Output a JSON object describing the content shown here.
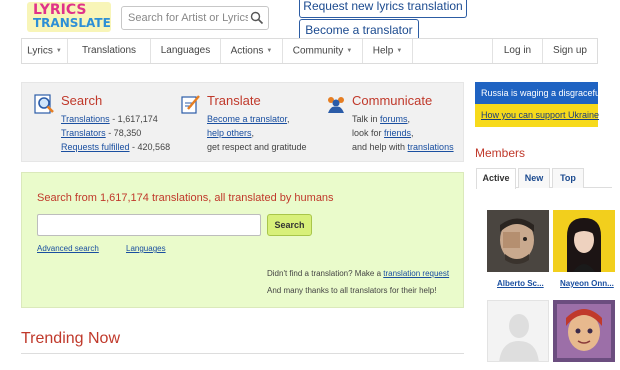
{
  "header": {
    "logo_line1": "LYRICS",
    "logo_line2": "TRANSLATE",
    "search_placeholder": "Search for Artist or Lyrics",
    "request_button": "Request new lyrics translation",
    "become_button": "Become a translator"
  },
  "nav": {
    "items": [
      "Lyrics",
      "Translations",
      "Languages",
      "Actions",
      "Community",
      "Help"
    ],
    "login": "Log in",
    "signup": "Sign up"
  },
  "features": {
    "search": {
      "title": "Search",
      "line1_link": "Translations",
      "line1_rest": " - 1,617,174",
      "line2_link": "Translators",
      "line2_rest": " - 78,350",
      "line3_link": "Requests fulfilled",
      "line3_rest": " - 420,568"
    },
    "translate": {
      "title": "Translate",
      "line1_link": "Become a translator",
      "line1_rest": ",",
      "line2_link": "help others",
      "line2_rest": ",",
      "line3": "get respect and gratitude"
    },
    "communicate": {
      "title": "Communicate",
      "line1_pre": "Talk in ",
      "line1_link": "forums",
      "line1_rest": ",",
      "line2_pre": "look for ",
      "line2_link": "friends",
      "line2_rest": ",",
      "line3_pre": "and help with ",
      "line3_link": "translations"
    }
  },
  "search_panel": {
    "title": "Search from 1,617,174 translations, all translated by humans",
    "input_value": "",
    "button": "Search",
    "advanced": "Advanced search",
    "languages": "Languages",
    "note1_pre": "Didn't find a translation? Make a ",
    "note1_link": "translation request",
    "note2": "And many thanks to all translators for their help!"
  },
  "trending": {
    "title": "Trending Now"
  },
  "ukraine": {
    "line1": "Russia is waging a disgraceful",
    "line2": "How you can support Ukraine"
  },
  "members": {
    "title": "Members",
    "tabs": [
      "Active",
      "New",
      "Top"
    ],
    "list": [
      {
        "name": "Alberto Sc..."
      },
      {
        "name": "Nayeon Onn..."
      },
      {
        "name": ""
      },
      {
        "name": ""
      }
    ]
  },
  "colors": {
    "accent_red": "#c0392b",
    "link_blue": "#1a4fa0",
    "search_panel_bg": "#eafbcb",
    "ukraine_blue": "#1f63c2",
    "ukraine_yellow": "#f7da1b"
  }
}
